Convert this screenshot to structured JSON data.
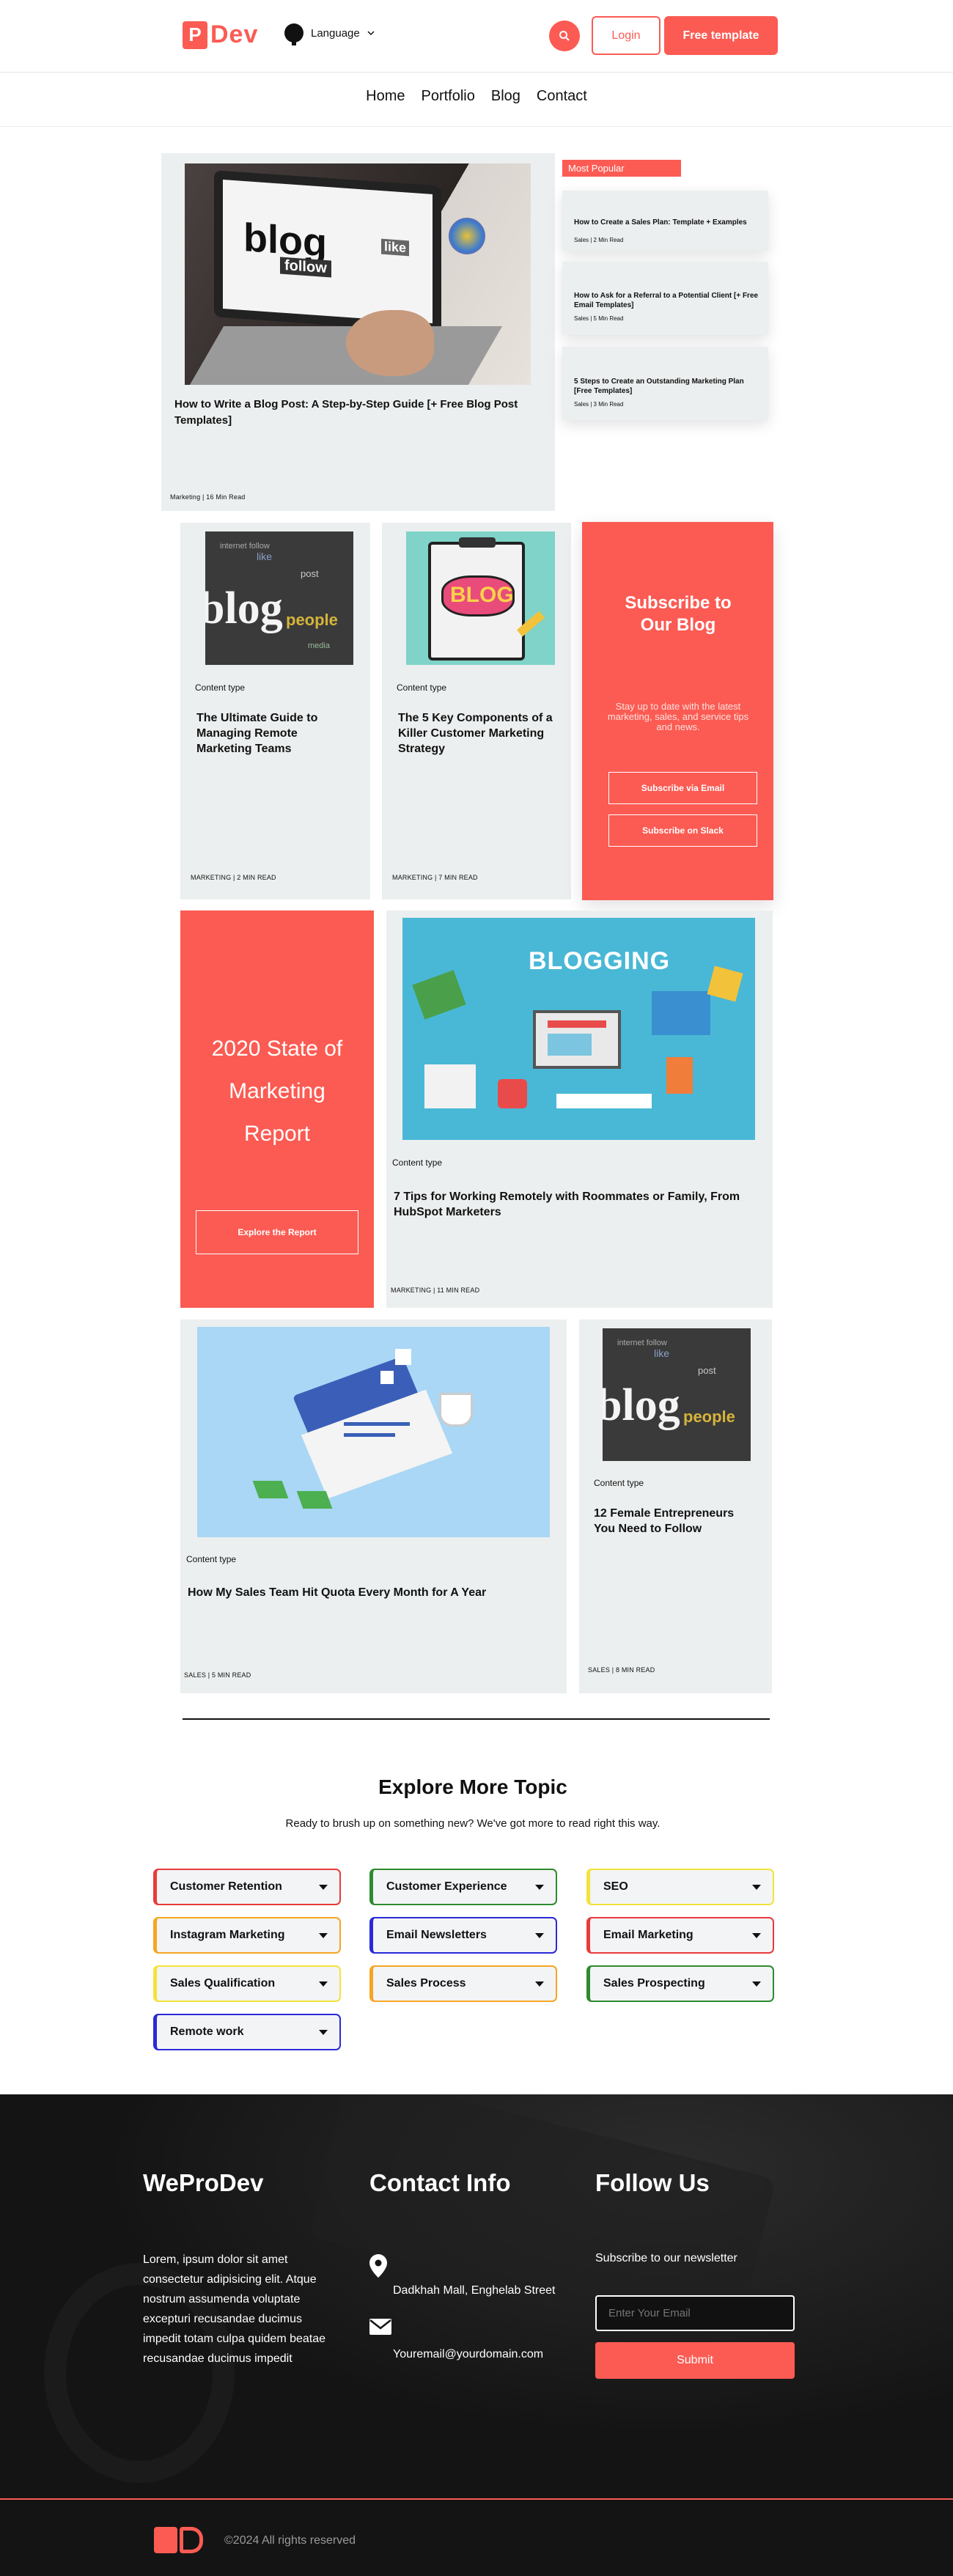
{
  "header": {
    "logo_text": "Dev",
    "logo_mark": "P",
    "language_label": "Language",
    "login_label": "Login",
    "cta_label": "Free template",
    "accent": "#fb5b53"
  },
  "nav": [
    "Home",
    "Portfolio",
    "Blog",
    "Contact"
  ],
  "featured": {
    "title": "How to Write a Blog Post: A Step-by-Step Guide [+ Free Blog Post Templates]",
    "meta": "Marketing | 16 Min Read",
    "image_words": [
      "blog",
      "follow",
      "like"
    ]
  },
  "most_popular": {
    "label": "Most Popular",
    "items": [
      {
        "title": "How to Create a Sales Plan: Template + Examples",
        "meta": "Sales | 2 Min Read"
      },
      {
        "title": "How to Ask for a Referral to a Potential Client [+ Free Email Templates]",
        "meta": "Sales | 5 Min Read"
      },
      {
        "title": "5 Steps to Create an Outstanding Marketing Plan [Free Templates]",
        "meta": "Sales | 3 Min Read"
      }
    ]
  },
  "row2": [
    {
      "type": "Content type",
      "title": "The Ultimate Guide to Managing Remote Marketing Teams",
      "meta": "MARKETING | 2 MIN READ"
    },
    {
      "type": "Content type",
      "title": "The 5 Key Components of a Killer Customer Marketing Strategy",
      "meta": "MARKETING | 7 MIN READ"
    }
  ],
  "subscribe": {
    "title": "Subscribe to Our Blog",
    "text": "Stay up to date with the latest marketing, sales, and service tips and news.",
    "email_btn": "Subscribe via Email",
    "slack_btn": "Subscribe on Slack"
  },
  "report": {
    "title": "2020 State of Marketing Report",
    "button": "Explore the Report"
  },
  "row3_card": {
    "type": "Content type",
    "title": "7 Tips for Working Remotely with Roommates or Family, From HubSpot Marketers",
    "meta": "MARKETING | 11 MIN READ",
    "image_heading": "BLOGGING"
  },
  "row4": [
    {
      "type": "Content type",
      "title": "How My Sales Team Hit Quota Every Month for A Year",
      "meta": "SALES | 5 MIN READ"
    },
    {
      "type": "Content type",
      "title": "12 Female Entrepreneurs You Need to Follow",
      "meta": "SALES | 8 MIN READ"
    }
  ],
  "explore": {
    "title": "Explore More Topic",
    "subtitle": "Ready to brush up on something new? We've got more to read right this way.",
    "topics": [
      {
        "label": "Customer Retention",
        "color": "#e83b3b"
      },
      {
        "label": "Customer Experience",
        "color": "#2e8b2e"
      },
      {
        "label": "SEO",
        "color": "#f2e33a"
      },
      {
        "label": "Instagram Marketing",
        "color": "#f5a623"
      },
      {
        "label": "Email Newsletters",
        "color": "#2a2ad8"
      },
      {
        "label": "Email Marketing",
        "color": "#e83b3b"
      },
      {
        "label": "Sales Qualification",
        "color": "#f2e33a"
      },
      {
        "label": "Sales Process",
        "color": "#f5a623"
      },
      {
        "label": "Sales Prospecting",
        "color": "#2e8b2e"
      },
      {
        "label": "Remote work",
        "color": "#2a2ad8"
      }
    ]
  },
  "footer": {
    "brand": "WeProDev",
    "about": "Lorem, ipsum dolor sit amet consectetur adipisicing elit. Atque nostrum assumenda voluptate excepturi recusandae ducimus impedit totam culpa quidem beatae recusandae ducimus impedit",
    "contact_title": "Contact Info",
    "address": "Dadkhah Mall, Enghelab Street",
    "email": "Youremail@yourdomain.com",
    "follow_title": "Follow Us",
    "newsletter_label": "Subscribe to our newsletter",
    "email_placeholder": "Enter Your Email",
    "submit_label": "Submit",
    "copyright": "©2024 All rights reserved",
    "logo_text": "PD"
  }
}
